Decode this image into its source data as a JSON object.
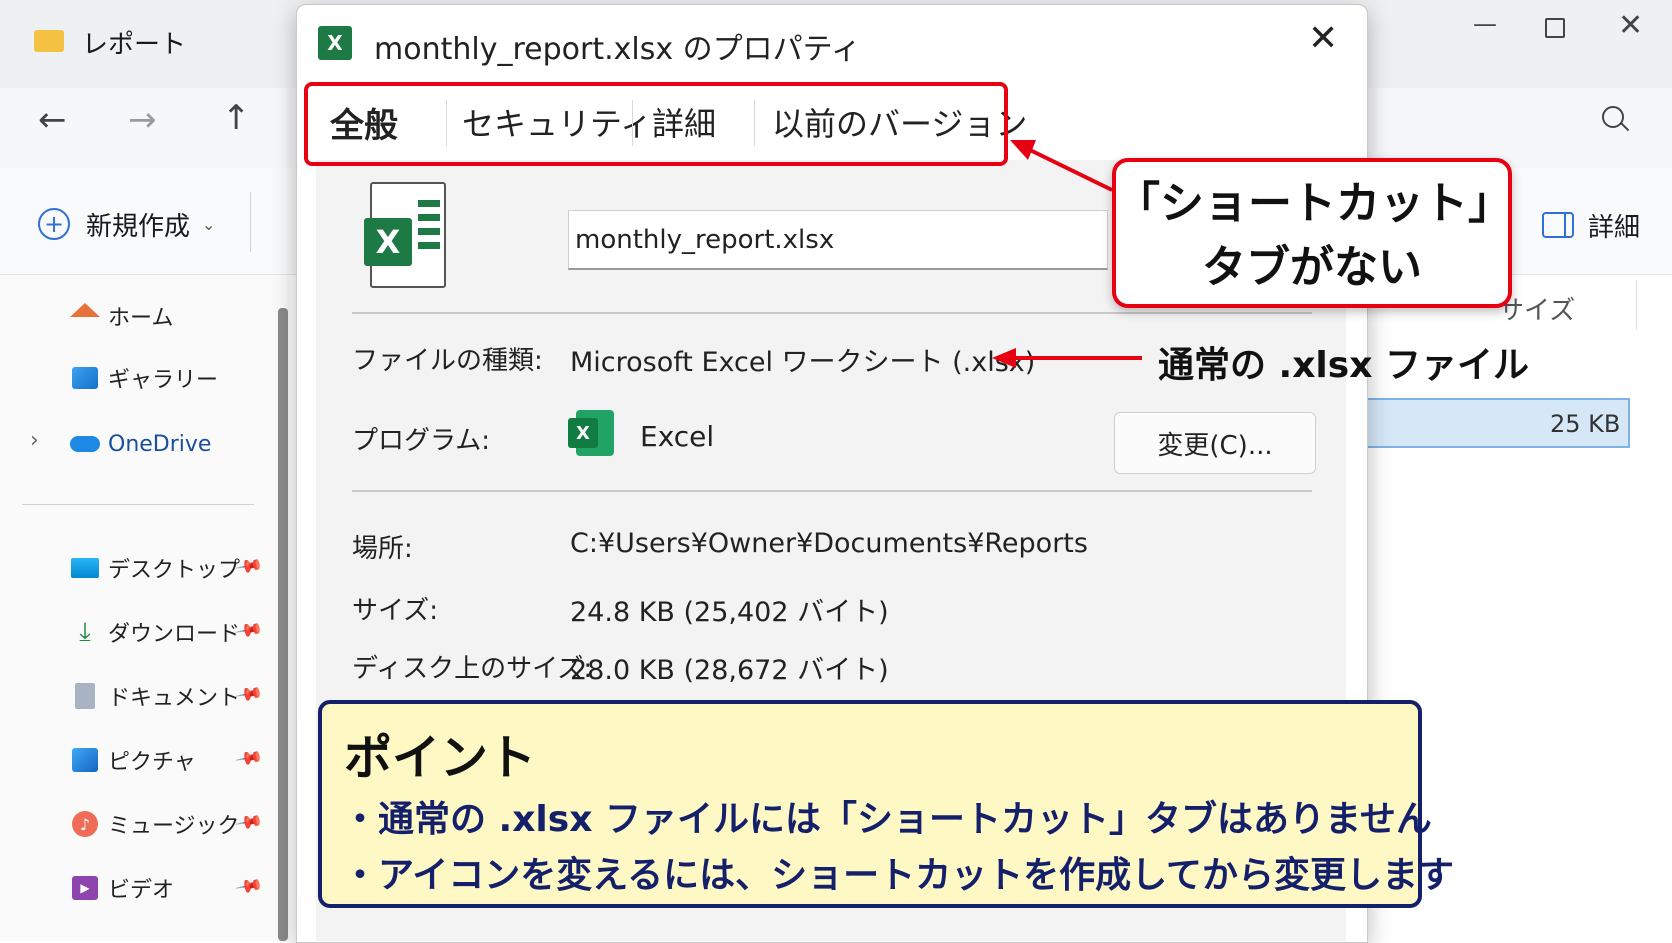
{
  "explorer": {
    "window_title": "レポート",
    "new_button": "新規作成",
    "details_button": "詳細",
    "column_size": "サイズ",
    "selected_file_size": "25 KB",
    "sidebar": {
      "home": "ホーム",
      "gallery": "ギャラリー",
      "onedrive": "OneDrive",
      "desktop": "デスクトップ",
      "downloads": "ダウンロード",
      "documents": "ドキュメント",
      "pictures": "ピクチャ",
      "music": "ミュージック",
      "videos": "ビデオ"
    }
  },
  "dialog": {
    "title": "monthly_report.xlsx のプロパティ",
    "tabs": [
      "全般",
      "セキュリティ",
      "詳細",
      "以前のバージョン"
    ],
    "active_tab": "全般",
    "filename_value": "monthly_report.xlsx",
    "file_type_label": "ファイルの種類:",
    "file_type_value": "Microsoft Excel ワークシート (.xlsx)",
    "program_label": "プログラム:",
    "program_value": "Excel",
    "change_button": "変更(C)...",
    "location_label": "場所:",
    "location_value": "C:¥Users¥Owner¥Documents¥Reports",
    "size_label": "サイズ:",
    "size_value": "24.8 KB (25,402 バイト)",
    "disk_size_label": "ディスク上のサイズ:",
    "disk_size_value": "28.0 KB (28,672 バイト)"
  },
  "annotations": {
    "callout_line1": "「ショートカット」",
    "callout_line2": "タブがない",
    "arrow_label": "通常の .xlsx ファイル",
    "point_title": "ポイント",
    "point_1": "・通常の .xlsx ファイルには「ショートカット」タブはありません",
    "point_2": "・アイコンを変えるには、ショートカットを作成してから変更します"
  },
  "colors": {
    "annotation_red": "#e60012",
    "point_border": "#15206b",
    "point_bg": "#fdf8c4",
    "excel_green": "#1d7a45",
    "selected_row": "#d6e8f8"
  }
}
